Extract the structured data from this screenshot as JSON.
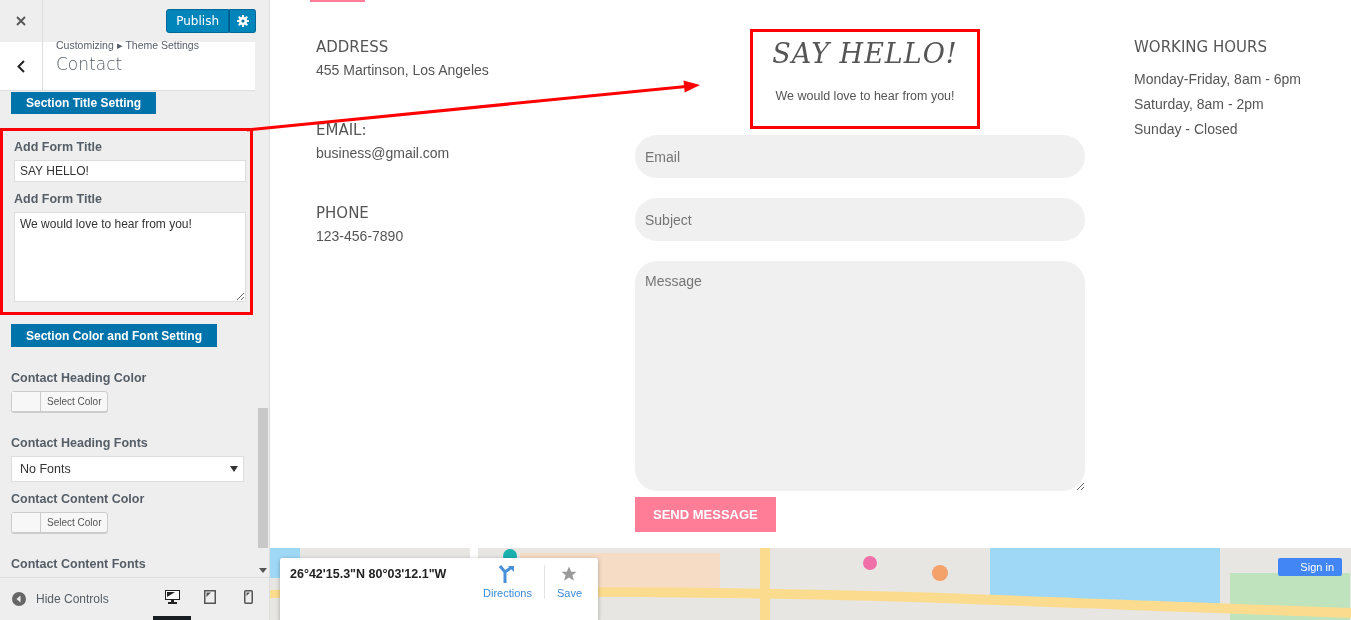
{
  "sidebar": {
    "publish": "Publish",
    "breadcrumb": "Customizing ▸ Theme Settings",
    "title": "Contact",
    "controls": [
      {
        "kind": "section-button",
        "label": "Section Title Setting"
      },
      {
        "kind": "group",
        "highlighted": true,
        "items": [
          {
            "kind": "text",
            "label": "Add Form Title",
            "value": "SAY HELLO!"
          },
          {
            "kind": "textarea",
            "label": "Add Form Title",
            "value": "We would love to hear from you!"
          }
        ]
      },
      {
        "kind": "section-button",
        "label": "Section Color and Font Setting"
      },
      {
        "kind": "color",
        "label": "Contact Heading Color",
        "button": "Select Color"
      },
      {
        "kind": "select",
        "label": "Contact Heading Fonts",
        "value": "No Fonts"
      },
      {
        "kind": "color",
        "label": "Contact Content Color",
        "button": "Select Color"
      },
      {
        "kind": "heading",
        "label": "Contact Content Fonts"
      }
    ],
    "footer": {
      "hide_controls": "Hide Controls",
      "devices": [
        {
          "kind": "desktop",
          "selected": true
        },
        {
          "kind": "tablet",
          "selected": false
        },
        {
          "kind": "mobile",
          "selected": false
        }
      ]
    }
  },
  "preview": {
    "contact_info": [
      {
        "heading": "ADDRESS",
        "text": "455 Martinson, Los Angeles"
      },
      {
        "heading": "EMAIL:",
        "text": "business@gmail.com"
      },
      {
        "heading": "PHONE",
        "text": "123-456-7890"
      }
    ],
    "form": {
      "title": "SAY HELLO!",
      "subtitle": "We would love to hear from you!",
      "highlighted": true,
      "fields": [
        {
          "kind": "input",
          "placeholder": "Email"
        },
        {
          "kind": "input",
          "placeholder": "Subject"
        },
        {
          "kind": "textarea",
          "placeholder": "Message"
        }
      ],
      "submit": "SEND MESSAGE"
    },
    "hours": {
      "heading": "WORKING HOURS",
      "lines": [
        "Monday-Friday, 8am - 6pm",
        "Saturday, 8am - 2pm",
        "Sunday - Closed"
      ]
    },
    "map": {
      "kind": "picture",
      "coordinates": "26°42'15.3\"N 80°03'12.1\"W",
      "actions": [
        {
          "kind": "directions",
          "label": "Directions"
        },
        {
          "kind": "save",
          "label": "Save"
        }
      ],
      "sign_in": "Sign in"
    }
  }
}
